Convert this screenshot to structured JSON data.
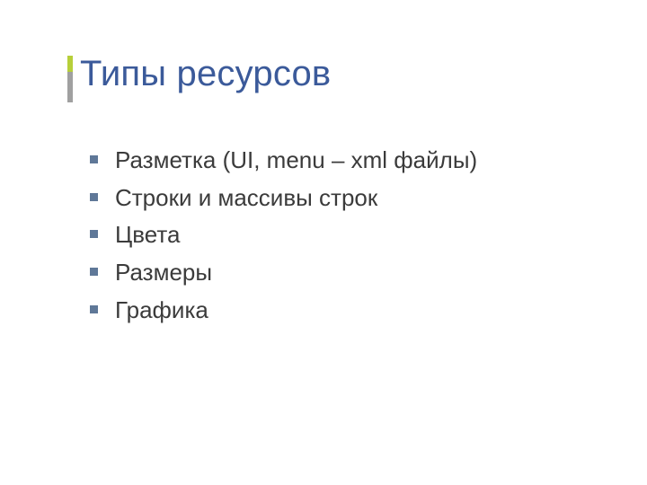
{
  "title": "Типы ресурсов",
  "bullets": [
    "Разметка (UI, menu – xml файлы)",
    "Строки и массивы строк",
    "Цвета",
    "Размеры",
    "Графика"
  ]
}
